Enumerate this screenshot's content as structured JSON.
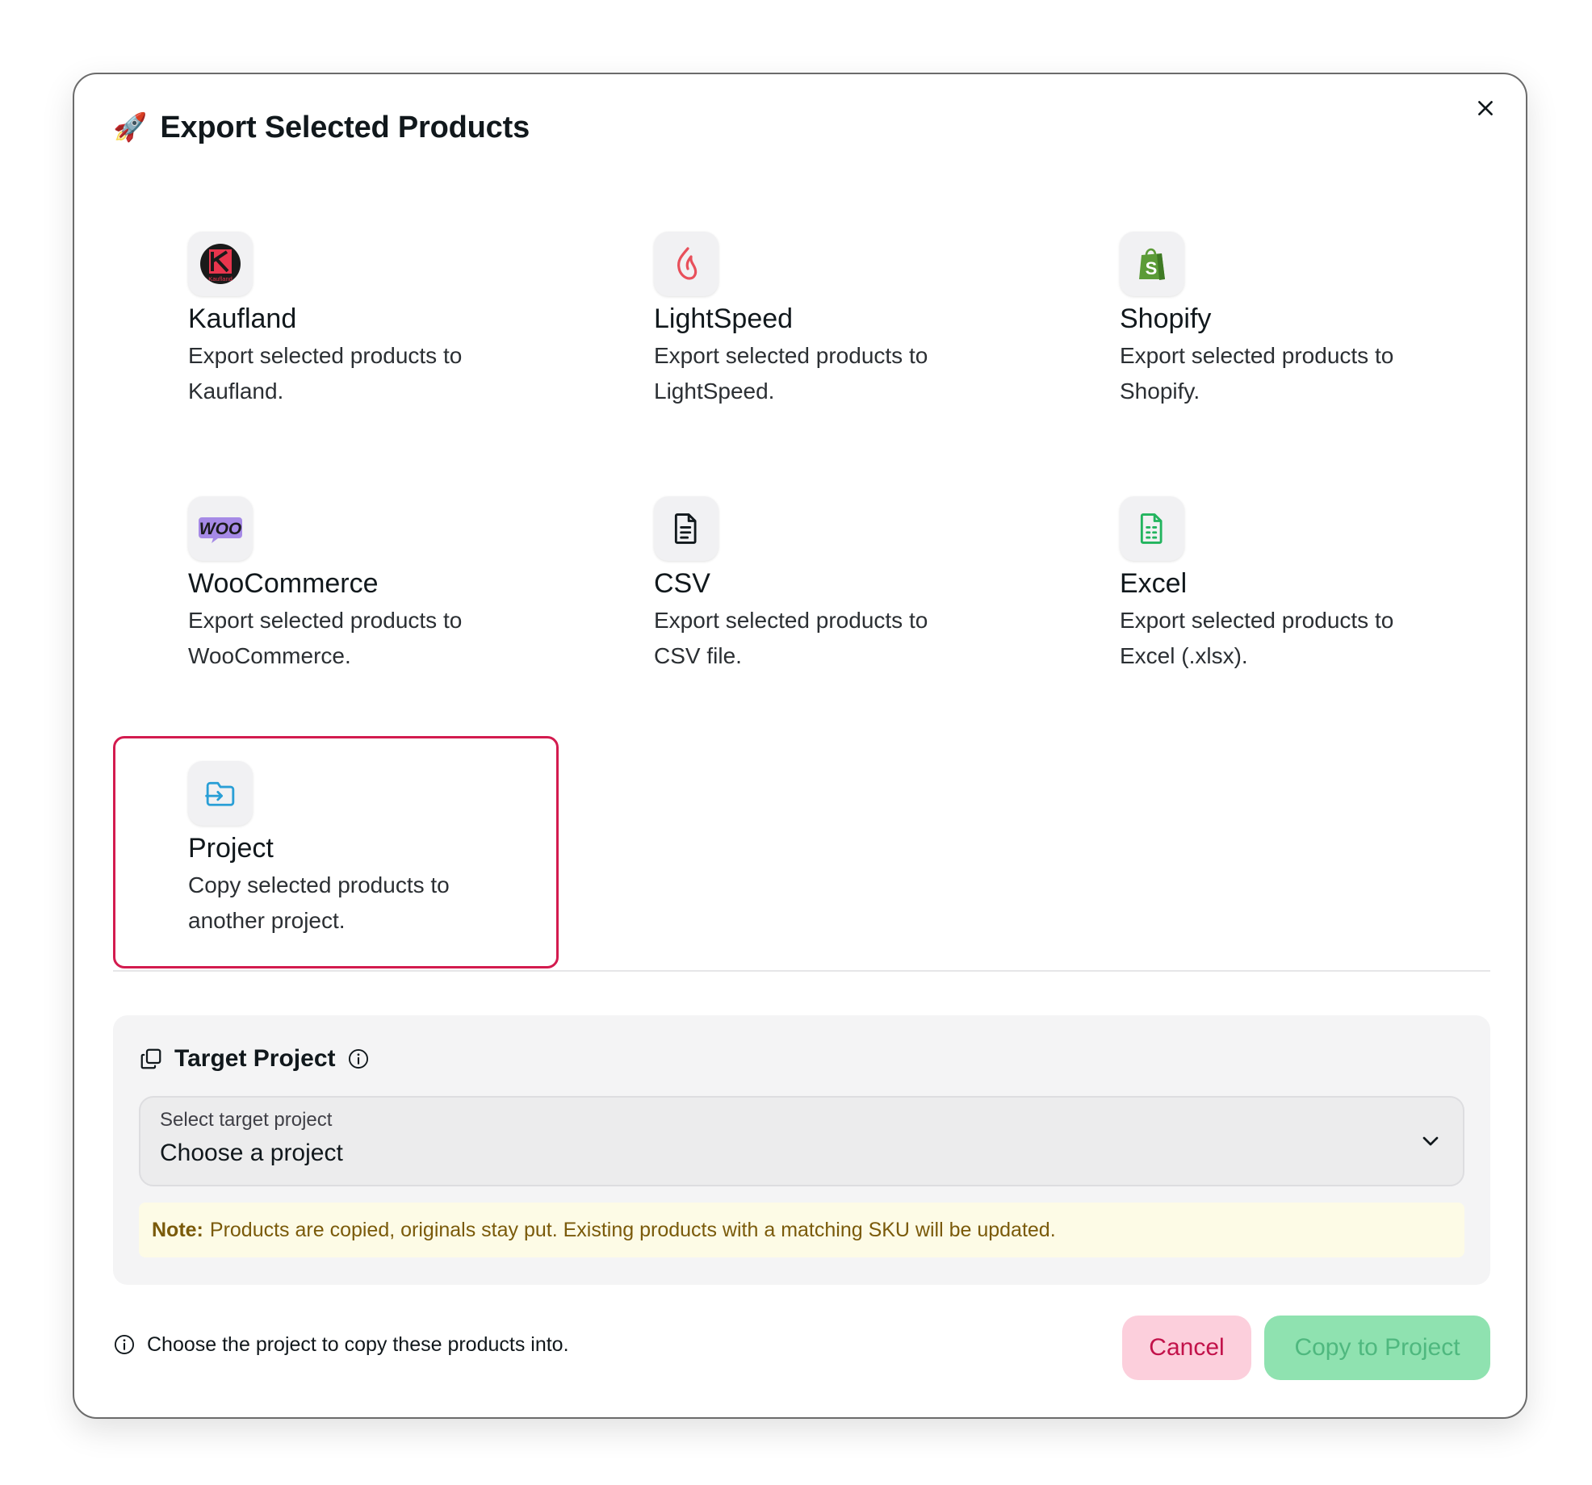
{
  "dialog": {
    "title_emoji": "🚀",
    "title": "Export Selected Products",
    "close_icon": "close-icon"
  },
  "export_options": [
    {
      "id": "kaufland",
      "icon": "kaufland-logo-icon",
      "title": "Kaufland",
      "description": "Export selected products to Kaufland.",
      "selected": false,
      "logo_text": "Kaufland"
    },
    {
      "id": "lightspeed",
      "icon": "lightspeed-flame-icon",
      "title": "LightSpeed",
      "description": "Export selected products to LightSpeed.",
      "selected": false
    },
    {
      "id": "shopify",
      "icon": "shopify-bag-icon",
      "title": "Shopify",
      "description": "Export selected products to Shopify.",
      "selected": false
    },
    {
      "id": "woocommerce",
      "icon": "woo-logo-icon",
      "title": "WooCommerce",
      "description": "Export selected products to WooCommerce.",
      "selected": false,
      "logo_text": "WOO"
    },
    {
      "id": "csv",
      "icon": "document-text-icon",
      "title": "CSV",
      "description": "Export selected products to CSV file.",
      "selected": false
    },
    {
      "id": "excel",
      "icon": "spreadsheet-icon",
      "title": "Excel",
      "description": "Export selected products to Excel (.xlsx).",
      "selected": false
    },
    {
      "id": "project",
      "icon": "folder-import-icon",
      "title": "Project",
      "description": "Copy selected products to another project.",
      "selected": true
    }
  ],
  "target_project": {
    "icon": "copy-icon",
    "title": "Target Project",
    "info_icon": "info-icon",
    "select": {
      "label": "Select target project",
      "value": "Choose a project",
      "chevron_icon": "chevron-down-icon"
    },
    "note": {
      "label": "Note:",
      "text": "Products are copied, originals stay put. Existing products with a matching SKU will be updated."
    }
  },
  "footer": {
    "hint_icon": "info-icon",
    "hint": "Choose the project to copy these products into.",
    "cancel_label": "Cancel",
    "copy_label": "Copy to Project"
  },
  "colors": {
    "selected_border": "#d31b4f",
    "cancel_bg": "#fccfdc",
    "cancel_text": "#c2124a",
    "copy_bg": "#8fe2b0",
    "copy_text": "#4fb87f",
    "note_bg": "#fdfbe6",
    "note_text": "#7a5a0a"
  }
}
